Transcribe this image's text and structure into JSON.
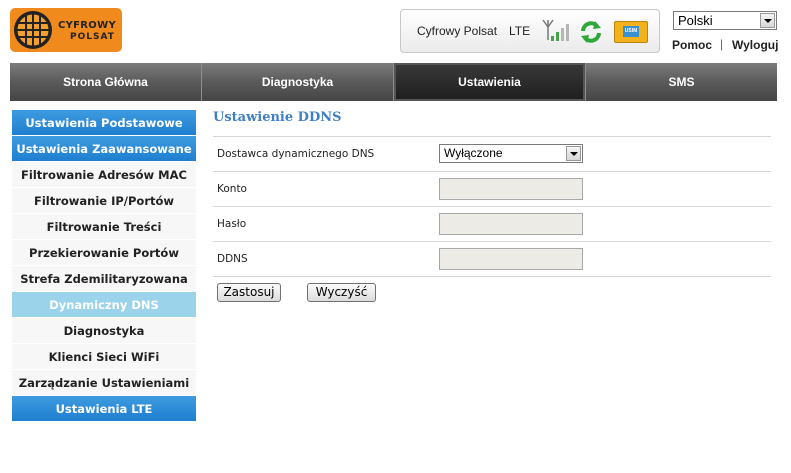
{
  "logo": {
    "line1": "CYFROWY",
    "line2": "POLSAT"
  },
  "status": {
    "operator": "Cyfrowy Polsat",
    "network_type": "LTE",
    "sim_label": "USIM",
    "icons": [
      "signal-bars-icon",
      "refresh-icon",
      "usim-card-icon"
    ]
  },
  "language": {
    "selected": "Polski"
  },
  "header_links": {
    "help": "Pomoc",
    "separator": "|",
    "logout": "Wyloguj"
  },
  "main_nav": [
    {
      "label": "Strona Główna",
      "active": false
    },
    {
      "label": "Diagnostyka",
      "active": false
    },
    {
      "label": "Ustawienia",
      "active": true
    },
    {
      "label": "SMS",
      "active": false
    }
  ],
  "sidebar": [
    {
      "label": "Ustawienia Podstawowe",
      "style": "blue"
    },
    {
      "label": "Ustawienia Zaawansowane",
      "style": "blue"
    },
    {
      "label": "Filtrowanie Adresów MAC",
      "style": "plain"
    },
    {
      "label": "Filtrowanie IP/Portów",
      "style": "plain"
    },
    {
      "label": "Filtrowanie Treści",
      "style": "plain"
    },
    {
      "label": "Przekierowanie Portów",
      "style": "plain"
    },
    {
      "label": "Strefa Zdemilitaryzowana",
      "style": "plain"
    },
    {
      "label": "Dynamiczny DNS",
      "style": "selected"
    },
    {
      "label": "Diagnostyka",
      "style": "plain"
    },
    {
      "label": "Klienci Sieci WiFi",
      "style": "plain"
    },
    {
      "label": "Zarządzanie Ustawieniami",
      "style": "plain"
    },
    {
      "label": "Ustawienia LTE",
      "style": "blue"
    }
  ],
  "page": {
    "title": "Ustawienie DDNS",
    "fields": {
      "provider_label": "Dostawca dynamicznego DNS",
      "provider_value": "Wyłączone",
      "account_label": "Konto",
      "account_value": "",
      "password_label": "Hasło",
      "password_value": "",
      "ddns_label": "DDNS",
      "ddns_value": ""
    },
    "buttons": {
      "apply": "Zastosuj",
      "clear": "Wyczyść"
    }
  },
  "colors": {
    "brand_orange": "#f08a1c",
    "sidebar_blue": "#1f7fd0",
    "sidebar_selected": "#9bd3ea",
    "title_blue": "#3f7fc4",
    "nav_dark": "#454545"
  }
}
